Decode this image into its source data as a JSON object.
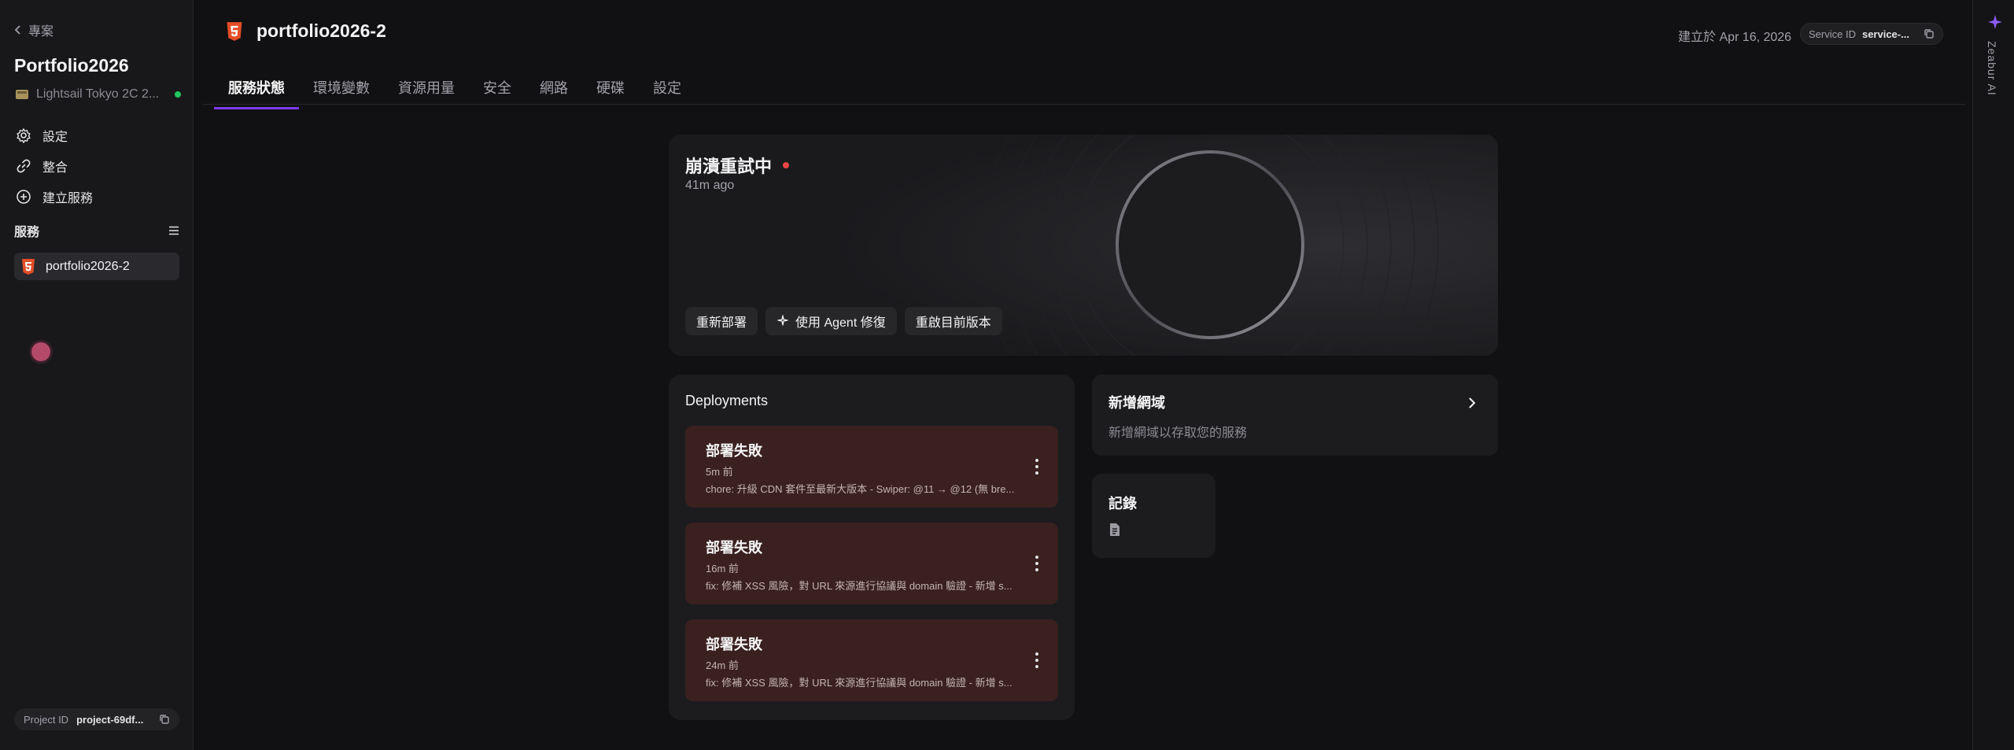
{
  "sidebar": {
    "back_label": "專案",
    "project_title": "Portfolio2026",
    "region": "Lightsail Tokyo 2C 2...",
    "nav": [
      {
        "label": "設定",
        "icon": "gear-icon"
      },
      {
        "label": "整合",
        "icon": "link-icon"
      },
      {
        "label": "建立服務",
        "icon": "plus-circle-icon"
      }
    ],
    "services_header": "服務",
    "service_item": "portfolio2026-2",
    "project_id_label": "Project ID",
    "project_id_value": "project-69df..."
  },
  "header": {
    "title": "portfolio2026-2",
    "created": "建立於 Apr 16, 2026",
    "service_id_label": "Service ID",
    "service_id_value": "service-..."
  },
  "tabs": [
    "服務狀態",
    "環境變數",
    "資源用量",
    "安全",
    "網路",
    "硬碟",
    "設定"
  ],
  "status": {
    "title": "崩潰重試中",
    "time": "41m ago",
    "actions": [
      "重新部署",
      "使用 Agent 修復",
      "重啟目前版本"
    ]
  },
  "deployments": {
    "title": "Deployments",
    "items": [
      {
        "status": "部署失敗",
        "time": "5m 前",
        "message": "chore: 升級 CDN 套件至最新大版本 - Swiper: @11 → @12 (無 bre..."
      },
      {
        "status": "部署失敗",
        "time": "16m 前",
        "message": "fix: 修補 XSS 風險，對 URL 來源進行協議與 domain 驗證 - 新增 s..."
      },
      {
        "status": "部署失敗",
        "time": "24m 前",
        "message": "fix: 修補 XSS 風險，對 URL 來源進行協議與 domain 驗證 - 新增 s..."
      }
    ]
  },
  "domain": {
    "title": "新增網域",
    "subtitle": "新增網域以存取您的服務"
  },
  "logs": {
    "title": "記錄"
  },
  "rail": {
    "label": "Zeabur AI"
  },
  "colors": {
    "accent": "#7c3aed",
    "error": "#ef4444",
    "success": "#22c55e",
    "failed_card": "#3a201f"
  }
}
